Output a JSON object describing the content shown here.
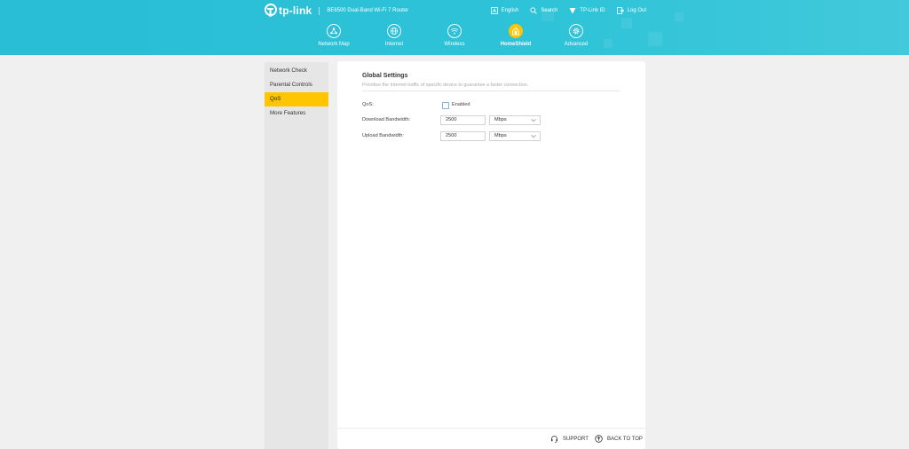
{
  "header": {
    "brand": "tp-link",
    "model": "BE6500 Dual-Band Wi-Fi 7 Router",
    "top_links": [
      {
        "label": "English",
        "icon": "language-icon"
      },
      {
        "label": "Search",
        "icon": "search-icon"
      },
      {
        "label": "TP-Link ID",
        "icon": "tplink-id-icon"
      },
      {
        "label": "Log Out",
        "icon": "logout-icon"
      }
    ],
    "nav": [
      {
        "label": "Network Map",
        "icon": "network-map-icon"
      },
      {
        "label": "Internet",
        "icon": "globe-icon"
      },
      {
        "label": "Wireless",
        "icon": "wifi-icon"
      },
      {
        "label": "HomeShield",
        "icon": "homeshield-icon",
        "active": true
      },
      {
        "label": "Advanced",
        "icon": "gear-icon"
      }
    ]
  },
  "sidebar": {
    "items": [
      {
        "label": "Network Check"
      },
      {
        "label": "Parental Controls"
      },
      {
        "label": "QoS",
        "active": true
      },
      {
        "label": "More Features"
      }
    ]
  },
  "main": {
    "title": "Global Settings",
    "description": "Prioritize the Internet traffic of specific device to guarantee a faster connection.",
    "qos": {
      "label": "QoS:",
      "checkbox_label": "Enabled",
      "checked": false
    },
    "download": {
      "label": "Download Bandwidth:",
      "value": "2500",
      "unit": "Mbps"
    },
    "upload": {
      "label": "Upload Bandwidth:",
      "value": "2500",
      "unit": "Mbps"
    }
  },
  "footer": {
    "support": "SUPPORT",
    "back_to_top": "BACK TO TOP"
  },
  "colors": {
    "header_bg": "#2ec3d8",
    "accent": "#ffc600"
  }
}
